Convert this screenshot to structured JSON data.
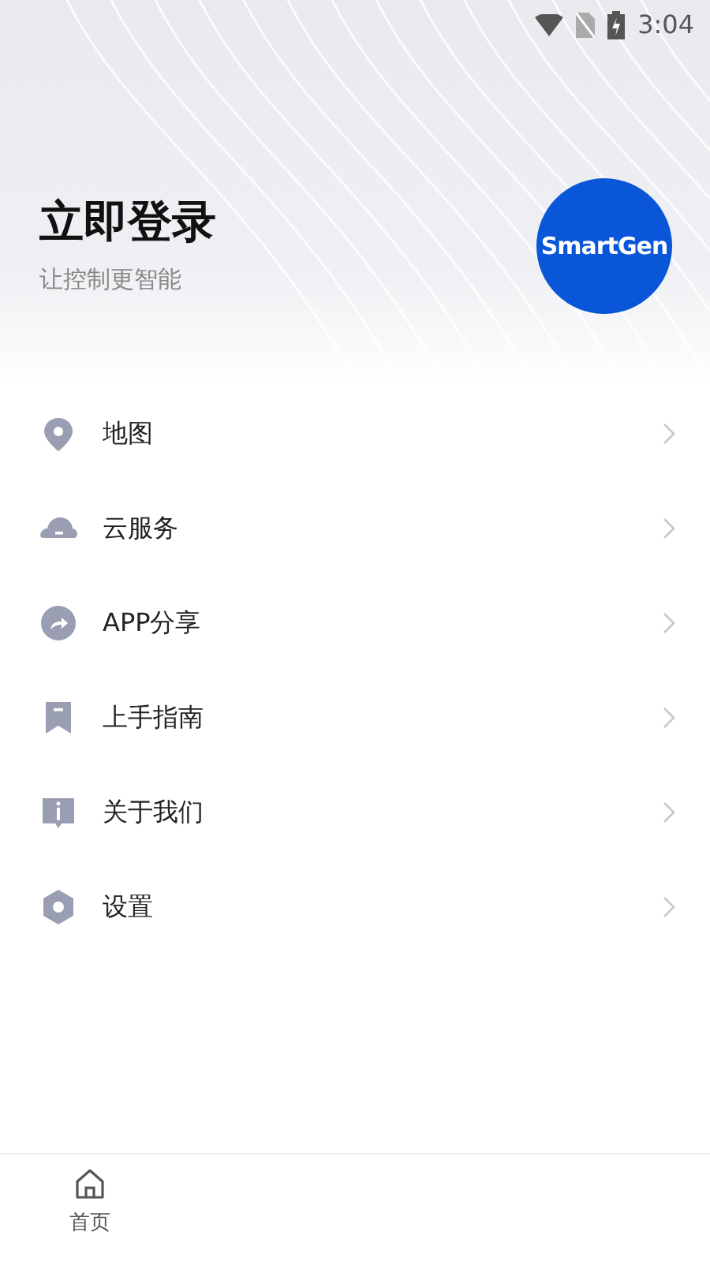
{
  "status_bar": {
    "time": "3:04"
  },
  "header": {
    "title": "立即登录",
    "subtitle": "让控制更智能",
    "logo_text": "SmartGen"
  },
  "menu": [
    {
      "label": "地图"
    },
    {
      "label": "云服务"
    },
    {
      "label": "APP分享"
    },
    {
      "label": "上手指南"
    },
    {
      "label": "关于我们"
    },
    {
      "label": "设置"
    }
  ],
  "bottom_nav": [
    {
      "label": "首页"
    }
  ]
}
